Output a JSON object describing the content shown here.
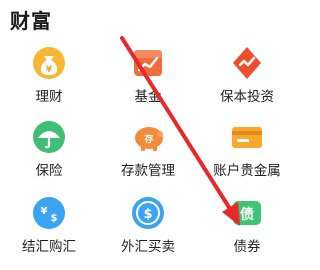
{
  "section": {
    "title": "财富"
  },
  "items": [
    {
      "label": "理财",
      "icon": "money-bag-icon",
      "color": "#f5a623"
    },
    {
      "label": "基金",
      "icon": "fund-chart-icon",
      "color": "#ef5a32"
    },
    {
      "label": "保本投资",
      "icon": "shield-trend-icon",
      "color": "#ef4d2c"
    },
    {
      "label": "保险",
      "icon": "umbrella-icon",
      "color": "#39b96e"
    },
    {
      "label": "存款管理",
      "icon": "piggy-bank-icon",
      "color": "#f2812e"
    },
    {
      "label": "账户贵金属",
      "icon": "gold-card-icon",
      "color": "#f4a127"
    },
    {
      "label": "结汇购汇",
      "icon": "currency-exchange-icon",
      "color": "#2f9bf0"
    },
    {
      "label": "外汇买卖",
      "icon": "dollar-coin-icon",
      "color": "#2f9bf0"
    },
    {
      "label": "债券",
      "icon": "bond-icon",
      "color": "#38bd6c"
    }
  ],
  "annotation": {
    "arrow_color": "#e8282a"
  }
}
